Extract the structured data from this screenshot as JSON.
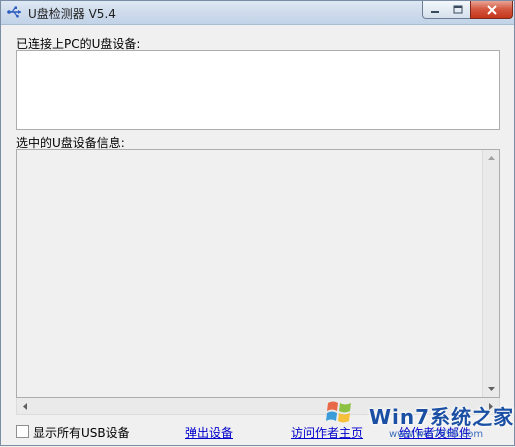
{
  "window": {
    "title": "U盘检测器 V5.4",
    "icon": "usb-icon"
  },
  "connected_section": {
    "label": "已连接上PC的U盘设备:",
    "items": []
  },
  "info_section": {
    "label": "选中的U盘设备信息:",
    "content": ""
  },
  "footer": {
    "show_all_usb_label": "显示所有USB设备",
    "show_all_usb_checked": false,
    "eject_label": "弹出设备",
    "visit_home_label": "访问作者主页",
    "email_label": "给作者发邮件"
  },
  "watermark": {
    "logo_text": "Win7系统之家",
    "url_text": "www.win7999.com"
  },
  "colors": {
    "link": "#0000cc",
    "titlebar": "#cfdcec",
    "close_button": "#c3361c",
    "window_bg": "#f0f0f0"
  }
}
